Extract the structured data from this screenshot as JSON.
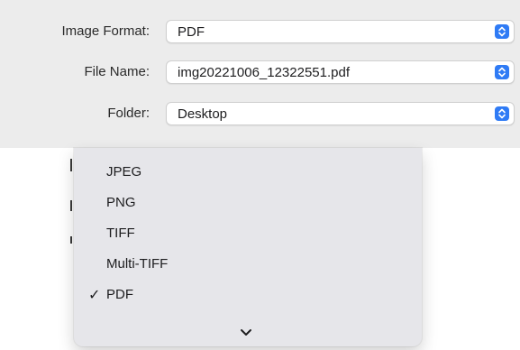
{
  "settings": {
    "image_format": {
      "label": "Image Format:",
      "value": "PDF"
    },
    "file_name": {
      "label": "File Name:",
      "value": "img20221006_12322551.pdf"
    },
    "folder": {
      "label": "Folder:",
      "value": "Desktop"
    }
  },
  "colors": {
    "accent": "#2f7bf5",
    "panel_background": "#ececec",
    "menu_background": "#e6e6ea"
  },
  "format_menu": {
    "items": [
      {
        "label": "JPEG",
        "checked": false
      },
      {
        "label": "PNG",
        "checked": false
      },
      {
        "label": "TIFF",
        "checked": false
      },
      {
        "label": "Multi-TIFF",
        "checked": false
      },
      {
        "label": "PDF",
        "checked": true,
        "check_glyph": "✓"
      }
    ],
    "more_indicator_icon": "chevron-down-icon"
  }
}
